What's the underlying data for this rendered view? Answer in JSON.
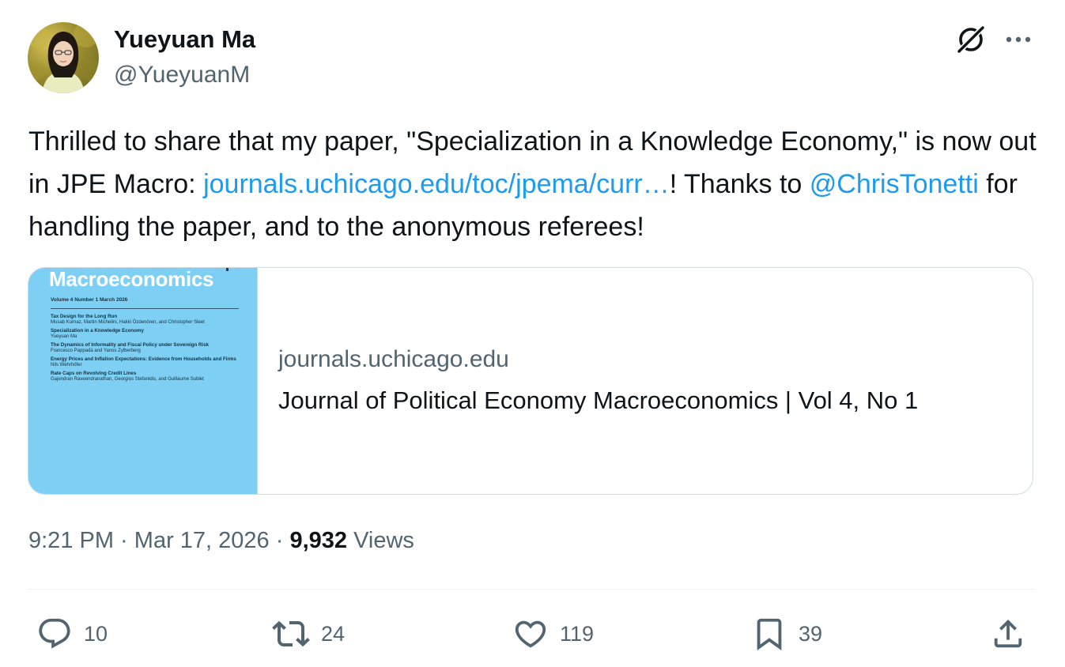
{
  "author": {
    "display_name": "Yueyuan Ma",
    "handle": "@YueyuanM"
  },
  "tweet": {
    "text_1": "Thrilled to share that my paper, \"Specialization in a Knowledge Economy,\" is now out in JPE Macro: ",
    "link_text": "journals.uchicago.edu/toc/jpema/curr…",
    "text_2": "! Thanks to ",
    "mention": "@ChrisTonetti",
    "text_3": " for handling the paper, and to the anonymous referees!"
  },
  "card": {
    "domain": "journals.uchicago.edu",
    "title": "Journal of Political Economy Macroeconomics | Vol 4, No 1",
    "cover": {
      "heading": "Macroeconomics",
      "issue_line": "Volume 4    Number 1    March 2026",
      "accent_color": "#7dcff3",
      "contents": [
        {
          "title": "Tax Design for the Long Run",
          "authors": "Musab Kurnaz, Martin Michelini, Hakki Özdenören, and Christopher Sleet"
        },
        {
          "title": "Specialization in a Knowledge Economy",
          "authors": "Yueyuan Ma"
        },
        {
          "title": "The Dynamics of Informality and Fiscal Policy under Sovereign Risk",
          "authors": "Francesco Pappadà and Yanos Zylberberg"
        },
        {
          "title": "Energy Prices and Inflation Expectations: Evidence from Households and Firms",
          "authors": "Nils Wehrhöfer"
        },
        {
          "title": "Rate Caps on Revolving Credit Lines",
          "authors": "Gajendran Raveendranathan, Georgios Stefanidis, and Guillaume Sublet"
        }
      ]
    }
  },
  "meta": {
    "time": "9:21 PM",
    "separator": " · ",
    "date": "Mar 17, 2026",
    "views_count": "9,932",
    "views_label": " Views"
  },
  "actions": {
    "reply": {
      "icon": "reply-icon",
      "count": "10"
    },
    "retweet": {
      "icon": "retweet-icon",
      "count": "24"
    },
    "like": {
      "icon": "heart-icon",
      "count": "119"
    },
    "bookmark": {
      "icon": "bookmark-icon",
      "count": "39"
    },
    "share": {
      "icon": "share-icon"
    }
  },
  "header_icons": [
    "grok-icon",
    "more-icon"
  ],
  "colors": {
    "text_primary": "#0f1419",
    "text_secondary": "#536471",
    "link": "#1d9bf0",
    "border": "#cfd9de"
  }
}
